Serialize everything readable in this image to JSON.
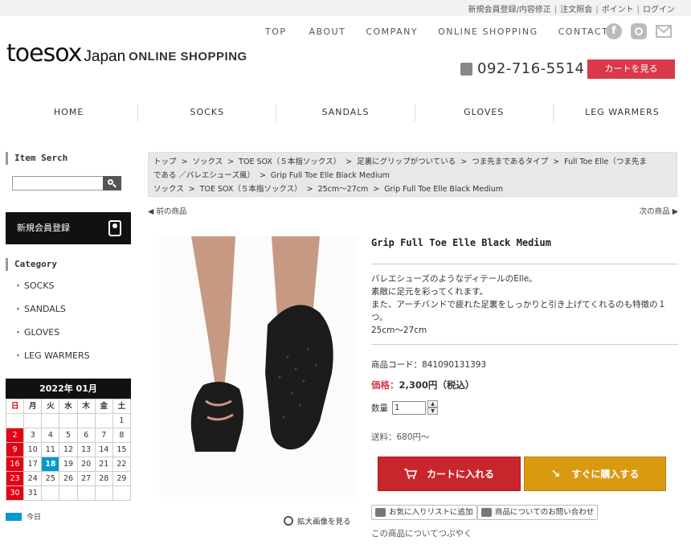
{
  "top_links": [
    "新規会員登録/内容修正",
    "注文照会",
    "ポイント",
    "ログイン"
  ],
  "logo": {
    "main": "toesox",
    "japan": "Japan",
    "shop": "ONLINE SHOPPING"
  },
  "main_nav": [
    "TOP",
    "ABOUT",
    "COMPANY",
    "ONLINE SHOPPING",
    "CONTACT"
  ],
  "social": {
    "facebook": "facebook-icon",
    "instagram": "instagram-icon",
    "mail": "mail-icon"
  },
  "phone": "092-716-5514",
  "cart_button": "カートを見る",
  "category_nav": [
    "HOME",
    "SOCKS",
    "SANDALS",
    "GLOVES",
    "LEG WARMERS"
  ],
  "sidebar": {
    "search_heading": "Item Serch",
    "search_placeholder": "",
    "register": "新規会員登録",
    "category_heading": "Category",
    "categories": [
      "SOCKS",
      "SANDALS",
      "GLOVES",
      "LEG WARMERS"
    ]
  },
  "calendar": {
    "title": "2022年 01月",
    "weekdays": [
      "日",
      "月",
      "火",
      "水",
      "木",
      "金",
      "土"
    ],
    "weeks": [
      [
        "",
        "",
        "",
        "",
        "",
        "",
        "1"
      ],
      [
        "2",
        "3",
        "4",
        "5",
        "6",
        "7",
        "8"
      ],
      [
        "9",
        "10",
        "11",
        "12",
        "13",
        "14",
        "15"
      ],
      [
        "16",
        "17",
        "18",
        "19",
        "20",
        "21",
        "22"
      ],
      [
        "23",
        "24",
        "25",
        "26",
        "27",
        "28",
        "29"
      ],
      [
        "30",
        "31",
        "",
        "",
        "",
        "",
        ""
      ]
    ],
    "today": "18",
    "legend_today": "今日"
  },
  "breadcrumbs": {
    "line1": [
      "トップ",
      "ソックス",
      "TOE SOX（５本指ソックス）",
      "足裏にグリップがついている",
      "つま先まであるタイプ",
      "Full Toe Elle（つま先ま"
    ],
    "line2": [
      "である ／バレエシューズ風）",
      "Grip Full Toe Elle Black Medium"
    ],
    "line3": [
      "ソックス",
      "TOE SOX（５本指ソックス）",
      "25cm〜27cm",
      "Grip Full Toe Elle Black Medium"
    ]
  },
  "prev": "前の商品",
  "next": "次の商品",
  "zoom": "拡大画像を見る",
  "product": {
    "title": "Grip Full Toe Elle Black Medium",
    "description": [
      "バレエシューズのようなディテールのElle。",
      "素敵に足元を彩ってくれます。",
      "また、アーチバンドで疲れた足裏をしっかりと引き上げてくれるのも特徴の１つ。",
      "25cm〜27cm"
    ],
    "code": "商品コード：841090131393",
    "price_label": "価格：",
    "price": "2,300円（税込）",
    "qty_label": "数量",
    "qty_value": "1",
    "shipping": "送料：680円〜",
    "add_cart": "カートに入れる",
    "buy_now": "すぐに購入する",
    "favorite": "お気に入りリストに追加",
    "inquiry": "商品についてのお問い合わせ",
    "tweet": "この商品についてつぶやく"
  }
}
